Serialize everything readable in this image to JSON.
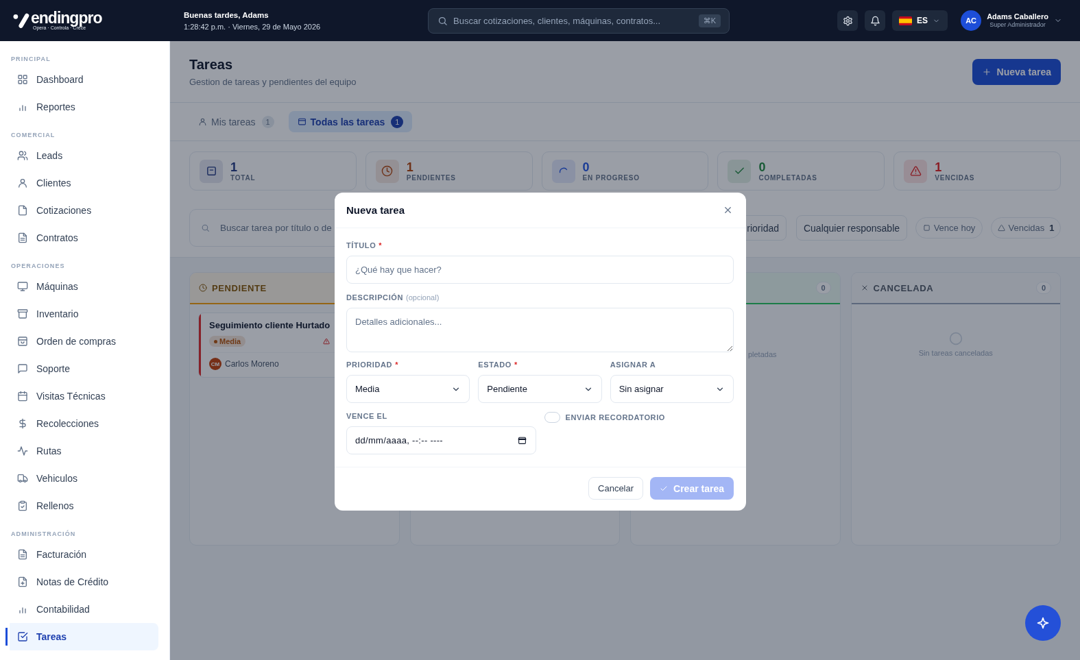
{
  "topbar": {
    "logo": {
      "name": "endingpro",
      "tagline": "Opera · Controla · Crece"
    },
    "greeting": "Buenas tardes, Adams",
    "datetime": "1:28:42 p.m. · Viernes, 29 de Mayo 2026",
    "search": {
      "placeholder": "Buscar cotizaciones, clientes, máquinas, contratos...",
      "shortcut": "⌘K"
    },
    "language": "ES",
    "user": {
      "initials": "AC",
      "name": "Adams Caballero",
      "role": "Super Administrador"
    }
  },
  "sidebar": {
    "sections": [
      {
        "title": "PRINCIPAL",
        "items": [
          {
            "label": "Dashboard",
            "selected": false
          },
          {
            "label": "Reportes",
            "selected": false
          }
        ]
      },
      {
        "title": "COMERCIAL",
        "items": [
          {
            "label": "Leads",
            "selected": false
          },
          {
            "label": "Clientes",
            "selected": false
          },
          {
            "label": "Cotizaciones",
            "selected": false
          },
          {
            "label": "Contratos",
            "selected": false
          }
        ]
      },
      {
        "title": "OPERACIONES",
        "items": [
          {
            "label": "Máquinas",
            "selected": false
          },
          {
            "label": "Inventario",
            "selected": false
          },
          {
            "label": "Orden de compras",
            "selected": false
          },
          {
            "label": "Soporte",
            "selected": false
          },
          {
            "label": "Visitas Técnicas",
            "selected": false
          },
          {
            "label": "Recolecciones",
            "selected": false
          },
          {
            "label": "Rutas",
            "selected": false
          },
          {
            "label": "Vehiculos",
            "selected": false
          },
          {
            "label": "Rellenos",
            "selected": false
          }
        ]
      },
      {
        "title": "ADMINISTRACIÓN",
        "items": [
          {
            "label": "Facturación",
            "selected": false
          },
          {
            "label": "Notas de Crédito",
            "selected": false
          },
          {
            "label": "Contabilidad",
            "selected": false
          },
          {
            "label": "Tareas",
            "selected": true
          }
        ]
      }
    ]
  },
  "page": {
    "title": "Tareas",
    "subtitle": "Gestion de tareas y pendientes del equipo",
    "primary_action": "Nueva tarea"
  },
  "tabs": [
    {
      "label": "Mis tareas",
      "count": "1",
      "selected": false
    },
    {
      "label": "Todas las tareas",
      "count": "1",
      "selected": true
    }
  ],
  "stats": [
    {
      "kind": "total",
      "value": "1",
      "label": "TOTAL"
    },
    {
      "kind": "pending",
      "value": "1",
      "label": "PENDIENTES"
    },
    {
      "kind": "in_progress",
      "value": "0",
      "label": "EN PROGRESO"
    },
    {
      "kind": "completed",
      "value": "0",
      "label": "COMPLETADAS"
    },
    {
      "kind": "overdue",
      "value": "1",
      "label": "VENCIDAS"
    }
  ],
  "filters": {
    "search": {
      "placeholder": "Buscar tarea por título o de"
    },
    "priority": "rioridad",
    "assignee": "Cualquier responsable",
    "chips": [
      {
        "label": "Vence hoy",
        "selected": false
      },
      {
        "label": "Vencidas",
        "count": "1",
        "selected": false
      }
    ]
  },
  "board": {
    "columns": [
      {
        "kind": "pending",
        "label": "PENDIENTE",
        "color": "#946516",
        "cards": [
          {
            "title": "Seguimiento cliente Hurtado",
            "color": "#862028",
            "priority": {
              "label": "Media",
              "color": "#6f3a17"
            },
            "overdue": true,
            "assignee": {
              "initials": "CM",
              "name": "Carlos Moreno"
            }
          }
        ]
      },
      {},
      {
        "count": "0",
        "color": "#1d7c48",
        "empty_text": "pletadas"
      },
      {
        "kind": "cancelled",
        "label": "CANCELADA",
        "count": "0",
        "color": "#5c687d",
        "empty_text": "Sin tareas canceladas"
      }
    ]
  },
  "modal": {
    "title": "Nueva tarea",
    "fields": [
      {
        "kind": "text",
        "label": "TÍTULO",
        "required_mark": "*",
        "placeholder": "¿Qué hay que hacer?"
      },
      {
        "kind": "textarea",
        "label": "DESCRIPCIÓN",
        "hint": "(opcional)",
        "placeholder": "Detalles adicionales..."
      }
    ],
    "selects": [
      {
        "label": "PRIORIDAD",
        "required_mark": "*",
        "value": "Media"
      },
      {
        "label": "ESTADO",
        "required_mark": "*",
        "value": "Pendiente"
      },
      {
        "label": "ASIGNAR A",
        "value": "Sin asignar"
      }
    ],
    "due": {
      "label": "VENCE EL",
      "placeholder": "dd/mm/aaaa, --:-- ----"
    },
    "reminder": {
      "label": "ENVIAR RECORDATORIO",
      "on": false
    },
    "buttons": [
      {
        "label": "Cancelar",
        "kind": "secondary",
        "disabled": false
      },
      {
        "label": "Crear tarea",
        "kind": "primary",
        "disabled": true
      }
    ]
  }
}
